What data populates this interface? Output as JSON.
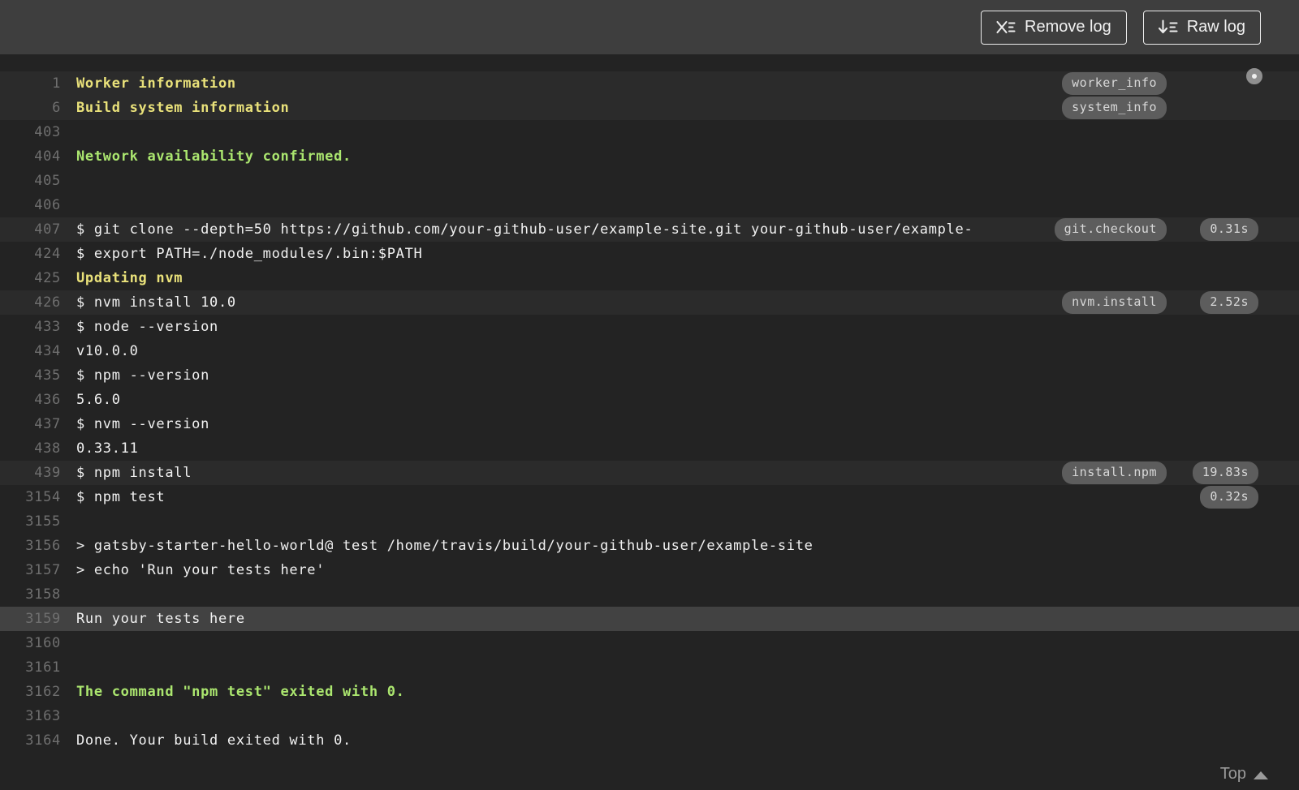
{
  "toolbar": {
    "remove_log_label": "Remove log",
    "raw_log_label": "Raw log"
  },
  "colors": {
    "header_bg": "#3e3e3e",
    "log_bg": "#232323",
    "fold_row_bg": "#2b2b2b",
    "selected_row_bg": "#424242",
    "text": "#f1f1f1",
    "yellow": "#e9e17a",
    "green": "#abe66f",
    "line_number": "#6f6f6f",
    "badge_bg": "#5d5d5d"
  },
  "log": {
    "top_link_label": "Top",
    "lines": [
      {
        "number": "1",
        "text": "Worker information",
        "style": "yellow",
        "fold": true,
        "tag": "worker_info"
      },
      {
        "number": "6",
        "text": "Build system information",
        "style": "yellow",
        "fold": true,
        "tag": "system_info"
      },
      {
        "number": "403",
        "text": ""
      },
      {
        "number": "404",
        "text": "Network availability confirmed.",
        "style": "green"
      },
      {
        "number": "405",
        "text": ""
      },
      {
        "number": "406",
        "text": ""
      },
      {
        "number": "407",
        "text": "$ git clone --depth=50 https://github.com/your-github-user/example-site.git your-github-user/example-",
        "fold": true,
        "tag": "git.checkout",
        "time": "0.31s"
      },
      {
        "number": "424",
        "text": "$ export PATH=./node_modules/.bin:$PATH"
      },
      {
        "number": "425",
        "text": "Updating nvm",
        "style": "yellow"
      },
      {
        "number": "426",
        "text": "$ nvm install 10.0",
        "fold": true,
        "tag": "nvm.install",
        "time": "2.52s"
      },
      {
        "number": "433",
        "text": "$ node --version"
      },
      {
        "number": "434",
        "text": "v10.0.0"
      },
      {
        "number": "435",
        "text": "$ npm --version"
      },
      {
        "number": "436",
        "text": "5.6.0"
      },
      {
        "number": "437",
        "text": "$ nvm --version"
      },
      {
        "number": "438",
        "text": "0.33.11"
      },
      {
        "number": "439",
        "text": "$ npm install",
        "fold": true,
        "tag": "install.npm",
        "time": "19.83s"
      },
      {
        "number": "3154",
        "text": "$ npm test",
        "time": "0.32s"
      },
      {
        "number": "3155",
        "text": ""
      },
      {
        "number": "3156",
        "text": "> gatsby-starter-hello-world@ test /home/travis/build/your-github-user/example-site"
      },
      {
        "number": "3157",
        "text": "> echo 'Run your tests here'"
      },
      {
        "number": "3158",
        "text": ""
      },
      {
        "number": "3159",
        "text": "Run your tests here",
        "selected": true
      },
      {
        "number": "3160",
        "text": ""
      },
      {
        "number": "3161",
        "text": ""
      },
      {
        "number": "3162",
        "text": "The command \"npm test\" exited with 0.",
        "style": "green"
      },
      {
        "number": "3163",
        "text": ""
      },
      {
        "number": "3164",
        "text": "Done. Your build exited with 0."
      }
    ]
  }
}
